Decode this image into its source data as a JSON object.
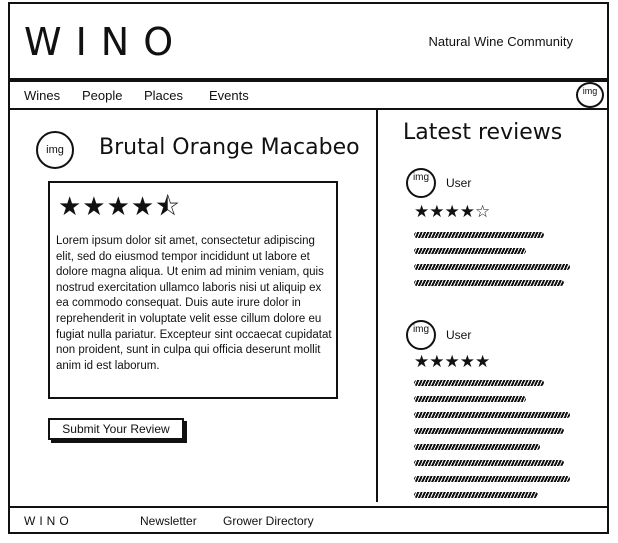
{
  "header": {
    "logo": "WINO",
    "tagline": "Natural Wine Community"
  },
  "nav": {
    "items": [
      {
        "label": "Wines"
      },
      {
        "label": "People"
      },
      {
        "label": "Places"
      },
      {
        "label": "Events"
      }
    ],
    "avatar_label": "img"
  },
  "product": {
    "image_label": "img",
    "title": "Brutal Orange Macabeo",
    "rating_stars": "★★★★⯪",
    "review_text": "Lorem ipsum dolor sit amet, consectetur adipiscing elit, sed do eiusmod tempor incididunt ut labore et dolore magna aliqua. Ut enim ad minim veniam, quis nostrud exercitation ullamco laboris nisi ut aliquip ex ea commodo consequat. Duis aute irure dolor in reprehenderit in voluptate velit esse cillum dolore eu fugiat nulla pariatur. Excepteur sint occaecat cupidatat non proident, sunt in culpa qui officia deserunt mollit anim id est laborum.",
    "submit_label": "Submit Your Review"
  },
  "latest": {
    "title": "Latest reviews",
    "reviews": [
      {
        "avatar_label": "img",
        "user": "User",
        "stars": "★★★★☆"
      },
      {
        "avatar_label": "img",
        "user": "User",
        "stars": "★★★★★"
      }
    ]
  },
  "footer": {
    "logo": "WINO",
    "links": [
      {
        "label": "Newsletter"
      },
      {
        "label": "Grower Directory"
      }
    ]
  }
}
